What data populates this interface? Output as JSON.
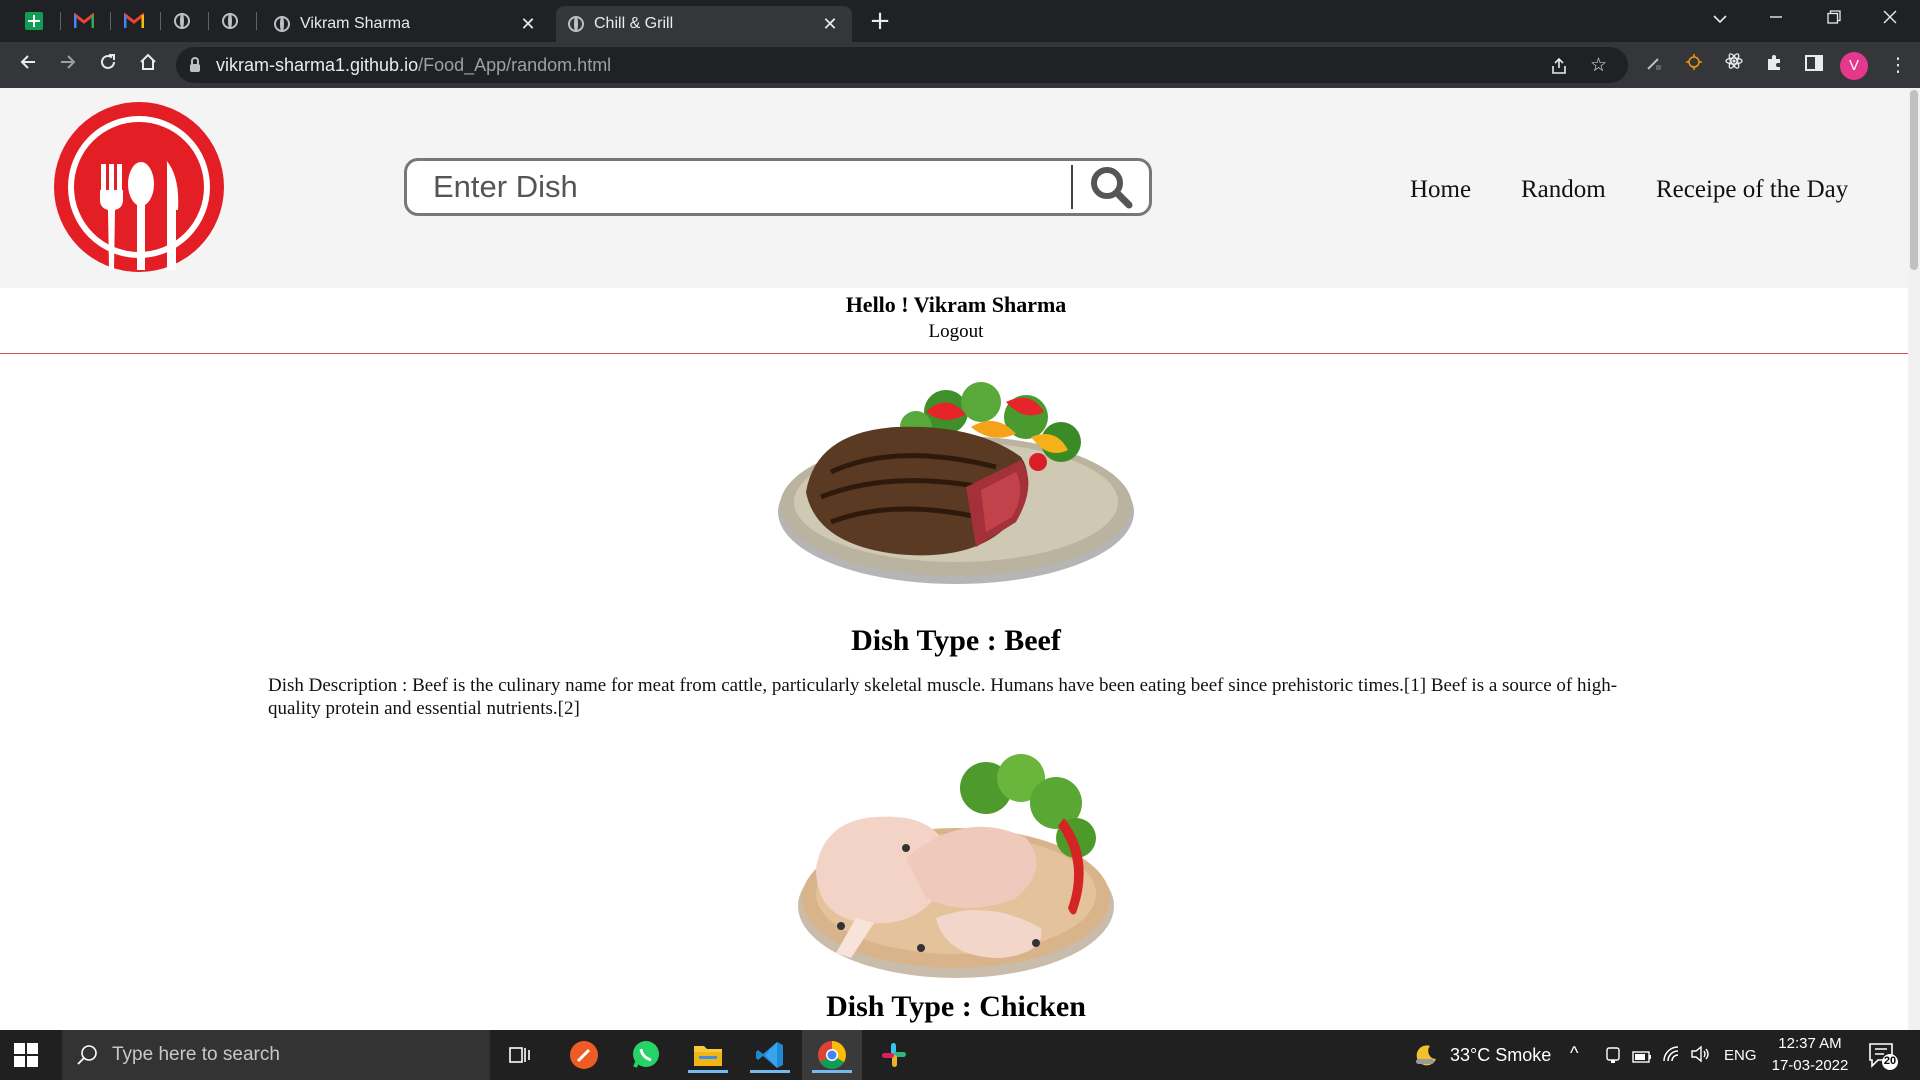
{
  "browser": {
    "tabs": [
      {
        "title": "Vikram Sharma",
        "active": false
      },
      {
        "title": "Chill & Grill",
        "active": true
      }
    ],
    "url_host": "vikram-sharma1.github.io",
    "url_path": "/Food_App/random.html",
    "profile_initial": "V"
  },
  "site": {
    "search_placeholder": "Enter Dish",
    "nav": [
      "Home",
      "Random",
      "Receipe of the Day"
    ],
    "greeting": "Hello ! Vikram Sharma",
    "logout": "Logout",
    "brand_color": "#e31e24",
    "divider_color": "#d9534f"
  },
  "dishes": [
    {
      "title": "Dish Type : Beef",
      "description": "Dish Description : Beef is the culinary name for meat from cattle, particularly skeletal muscle. Humans have been eating beef since prehistoric times.[1] Beef is a source of high-quality protein and essential nutrients.[2]",
      "image": "grilled-steak-on-plate"
    },
    {
      "title": "Dish Type : Chicken",
      "description": "",
      "image": "raw-chicken-legs-on-board"
    }
  ],
  "taskbar": {
    "search_placeholder": "Type here to search",
    "weather": "33°C  Smoke",
    "language": "ENG",
    "time": "12:37 AM",
    "date": "17-03-2022",
    "notifications": "20"
  }
}
